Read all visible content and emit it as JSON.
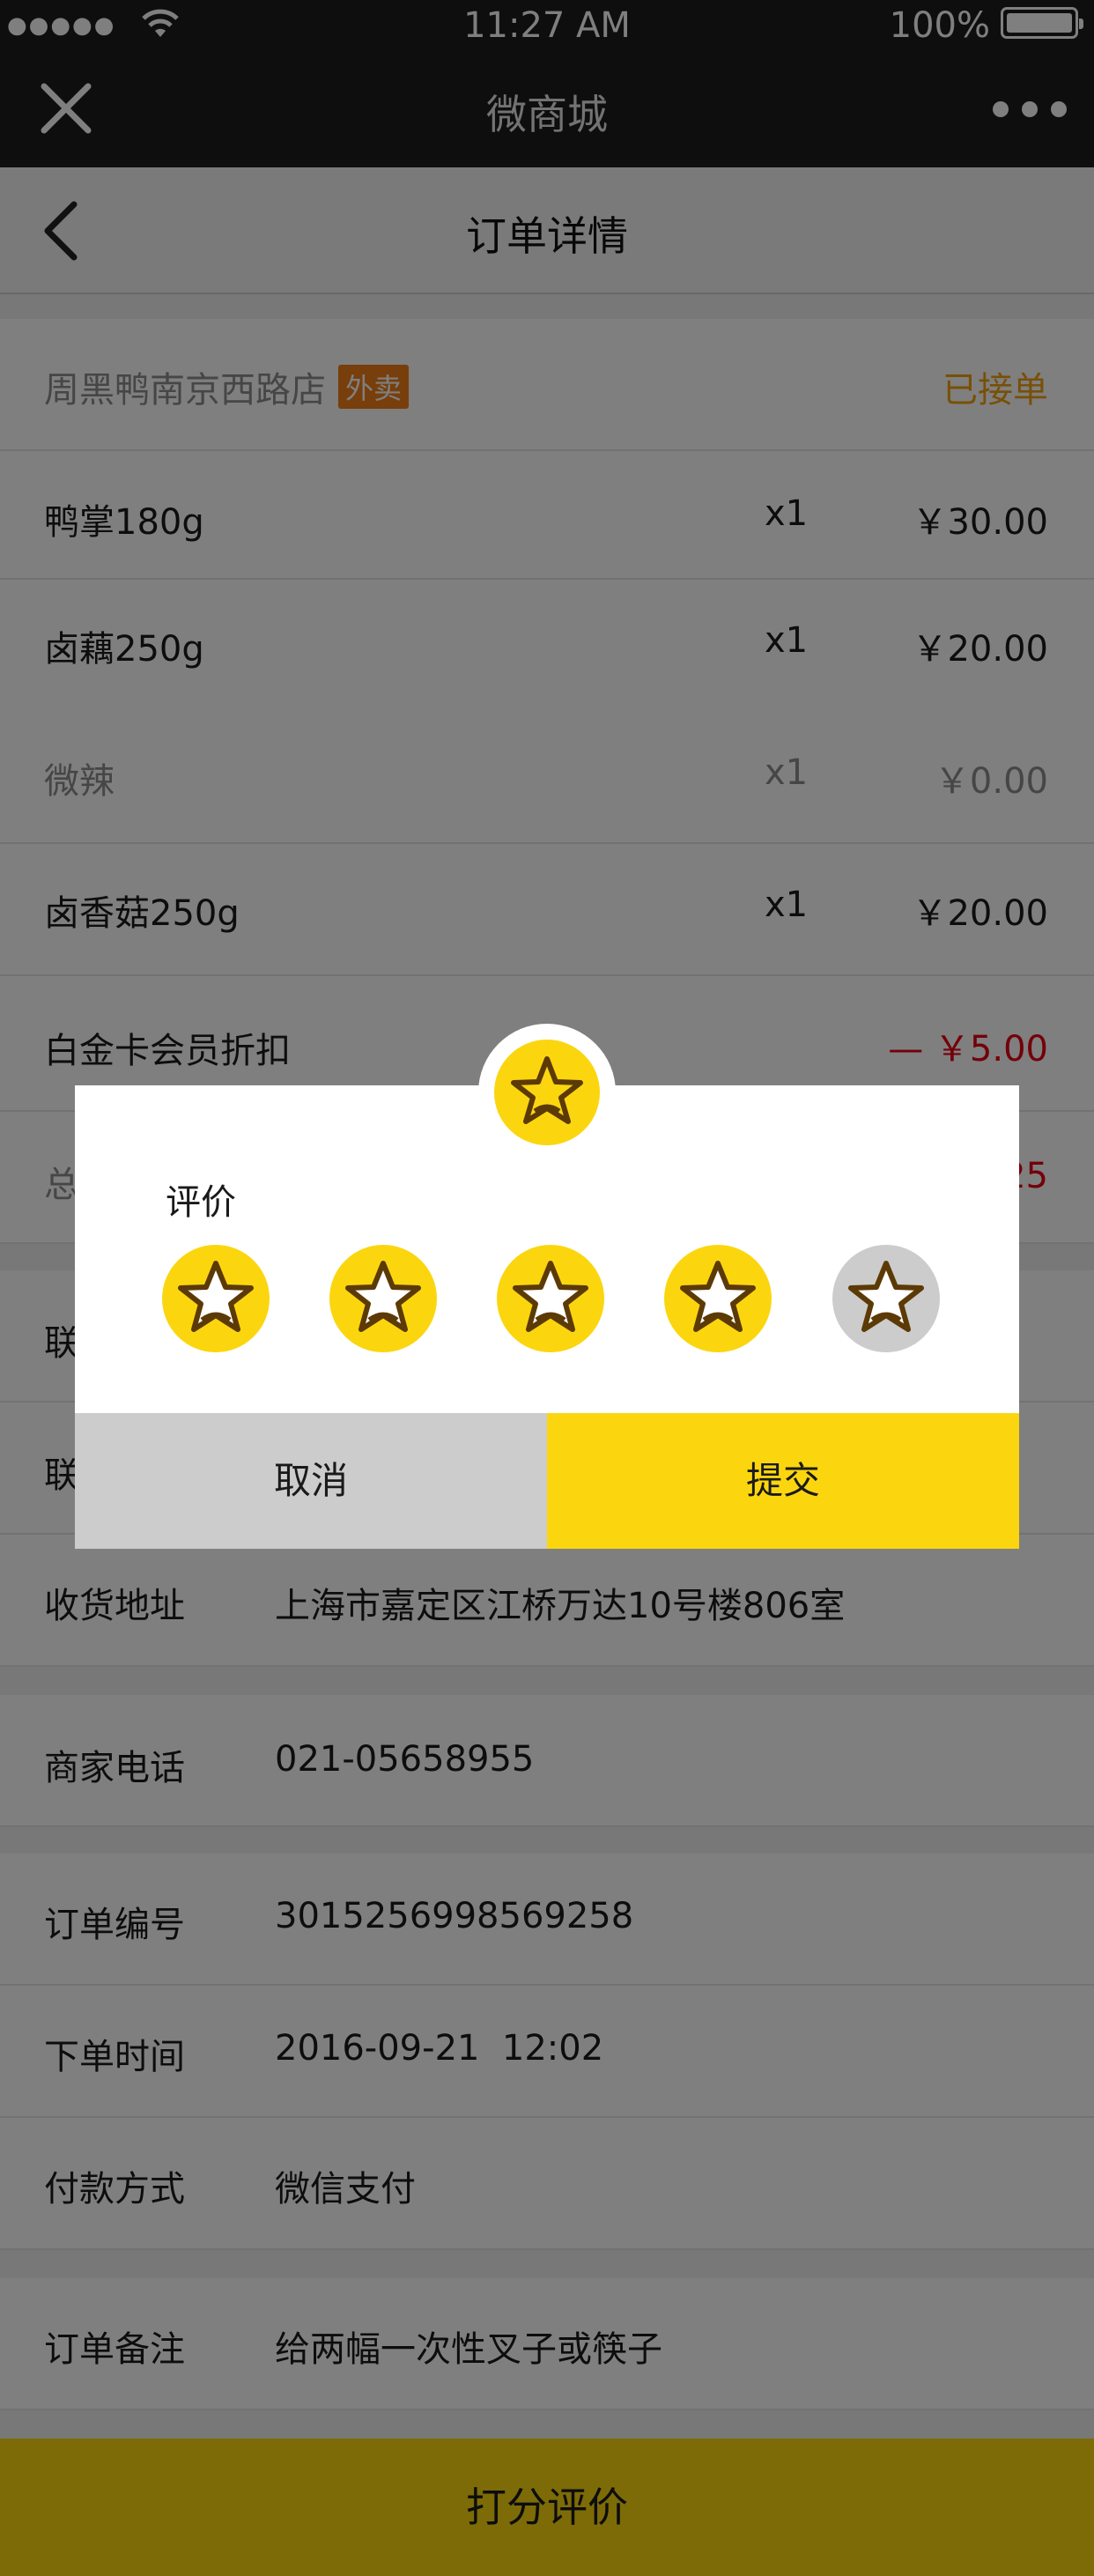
{
  "status_bar": {
    "signal": "●●●●●",
    "time": "11:27 AM",
    "battery": "100%"
  },
  "wechat_bar": {
    "title": "微商城"
  },
  "nav": {
    "title": "订单详情"
  },
  "store": {
    "name": "周黑鸭南京西路店",
    "tag": "外卖",
    "status": "已接单"
  },
  "items": [
    {
      "name": "鸭掌180g",
      "qty": "x1",
      "price": "￥30.00"
    },
    {
      "name": "卤藕250g",
      "qty": "x1",
      "price": "￥20.00"
    },
    {
      "name": "微辣",
      "qty": "x1",
      "price": "￥0.00"
    },
    {
      "name": "卤香菇250g",
      "qty": "x1",
      "price": "￥20.00"
    }
  ],
  "discount": {
    "label": "白金卡会员折扣",
    "value": "— ￥5.00"
  },
  "total": {
    "label_partial": "总",
    "value_partial": "25"
  },
  "contact_partial": {
    "label1": "联",
    "label2": "联"
  },
  "info": {
    "address": {
      "label": "收货地址",
      "value": "上海市嘉定区江桥万达10号楼806室"
    },
    "phone": {
      "label": "商家电话",
      "value": "021-05658955"
    },
    "order_no": {
      "label": "订单编号",
      "value": "3015256998569258"
    },
    "order_time": {
      "label": "下单时间",
      "value": "2016-09-21  12:02"
    },
    "payment": {
      "label": "付款方式",
      "value": "微信支付"
    },
    "note": {
      "label": "订单备注",
      "value": "给两幅一次性叉子或筷子"
    }
  },
  "bottom_button": "打分评价",
  "rating_dialog": {
    "label": "评价",
    "rating": 4,
    "max_rating": 5,
    "cancel": "取消",
    "submit": "提交"
  },
  "colors": {
    "accent": "#fbd60f",
    "status": "#f0a10f",
    "discount": "#e60012",
    "badge": "#f07c16",
    "inactive_star": "#cccccc"
  }
}
